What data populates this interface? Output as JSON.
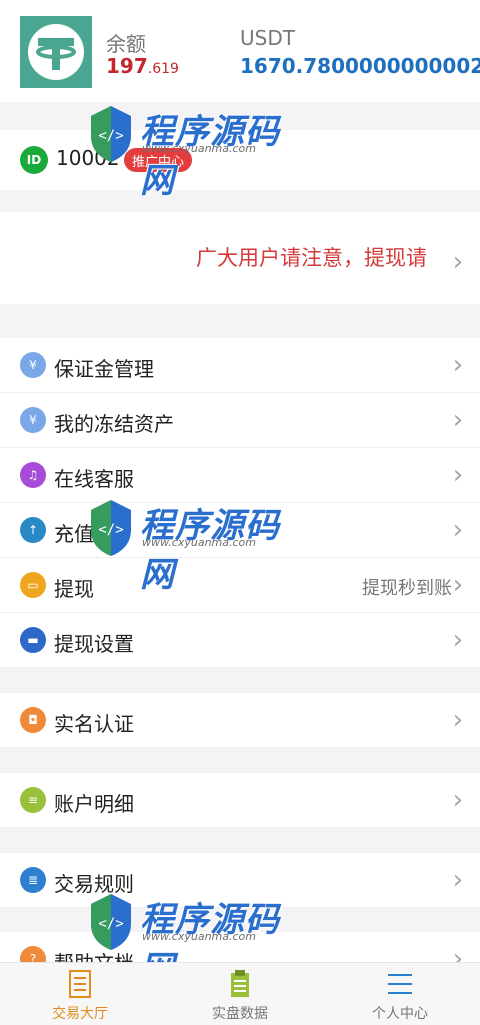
{
  "header": {
    "balance_label": "余额",
    "balance_int": "197",
    "balance_dec": ".619",
    "usdt_label": "USDT",
    "usdt_amount": "1670.7800000000002",
    "usdt_arrow": "个"
  },
  "id_row": {
    "icon_text": "ID",
    "id_number": "10002",
    "promo_label": "推广中心"
  },
  "notice": {
    "text": "广大用户请注意，提现请"
  },
  "menu": [
    {
      "name": "margin-management",
      "label": "保证金管理",
      "right_text": "",
      "icon": "yen-icon",
      "color": "#7aa7e8"
    },
    {
      "name": "frozen-assets",
      "label": "我的冻结资产",
      "right_text": "",
      "icon": "yen-icon",
      "color": "#7aa7e8"
    },
    {
      "name": "online-service",
      "label": "在线客服",
      "right_text": "",
      "icon": "headset-icon",
      "color": "#a84bd8"
    },
    {
      "name": "recharge",
      "label": "充值",
      "right_text": "",
      "icon": "recharge-icon",
      "color": "#2a88c7"
    },
    {
      "name": "withdraw",
      "label": "提现",
      "right_text": "提现秒到账",
      "icon": "wallet-icon",
      "color": "#f0a51e"
    },
    {
      "name": "withdraw-settings",
      "label": "提现设置",
      "right_text": "",
      "icon": "card-icon",
      "color": "#2e68c8"
    },
    {
      "name": "real-name-auth",
      "label": "实名认证",
      "right_text": "",
      "icon": "id-card-icon",
      "color": "#ee8a3a"
    },
    {
      "name": "account-details",
      "label": "账户明细",
      "right_text": "",
      "icon": "ledger-icon",
      "color": "#9abf3b"
    },
    {
      "name": "trading-rules",
      "label": "交易规则",
      "right_text": "",
      "icon": "document-icon",
      "color": "#2e7fd0"
    },
    {
      "name": "help-docs",
      "label": "帮助文档",
      "right_text": "",
      "icon": "help-icon",
      "color": "#ee8a3a"
    }
  ],
  "tabbar": {
    "tabs": [
      {
        "label": "交易大厅",
        "icon": "list-icon"
      },
      {
        "label": "实盘数据",
        "icon": "clipboard-icon"
      },
      {
        "label": "个人中心",
        "icon": "menu-icon"
      }
    ]
  },
  "watermark": {
    "title": "程序源码网",
    "url": "www.cxyuanma.com"
  }
}
